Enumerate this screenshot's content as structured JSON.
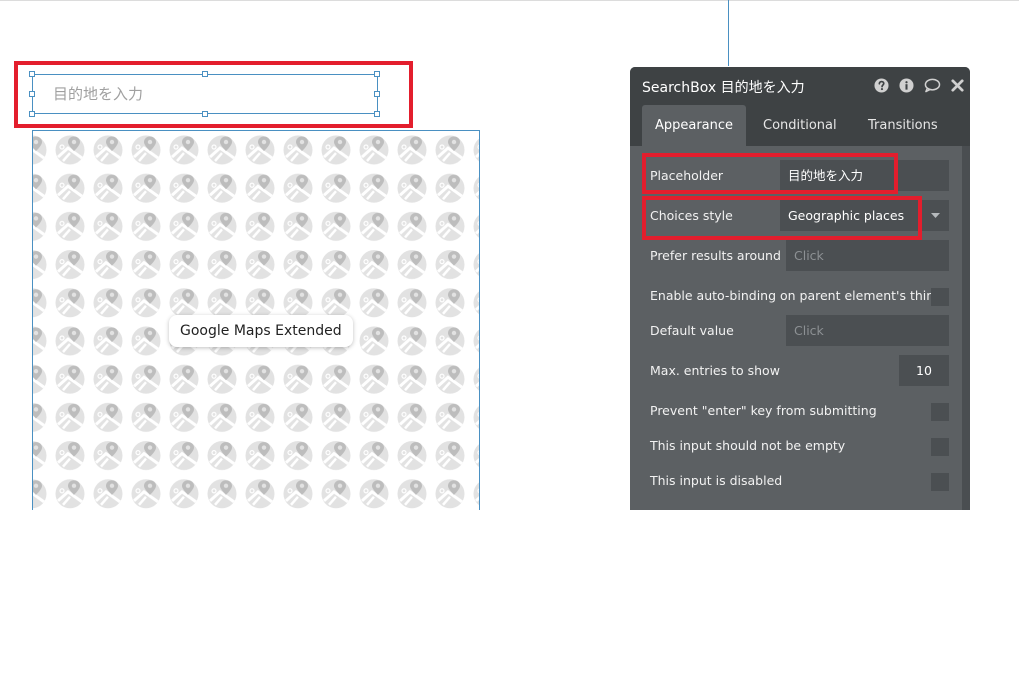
{
  "canvas": {
    "searchbox": {
      "placeholder": "目的地を入力"
    },
    "map": {
      "label": "Google Maps Extended"
    }
  },
  "panel": {
    "title": "SearchBox 目的地を入力",
    "header_icons": [
      "help-icon",
      "info-icon",
      "comment-icon",
      "close-icon"
    ],
    "tabs": [
      {
        "label": "Appearance",
        "active": true
      },
      {
        "label": "Conditional"
      },
      {
        "label": "Transitions"
      }
    ],
    "rows": {
      "placeholder": {
        "label": "Placeholder",
        "value": "目的地を入力"
      },
      "choices_style": {
        "label": "Choices style",
        "value": "Geographic places"
      },
      "prefer_results": {
        "label": "Prefer results around",
        "value": "Click"
      },
      "auto_binding": {
        "label": "Enable auto-binding on parent element's thing"
      },
      "default_value": {
        "label": "Default value",
        "value": "Click"
      },
      "max_entries": {
        "label": "Max. entries to show",
        "value": "10"
      },
      "prevent_enter": {
        "label": "Prevent \"enter\" key from submitting"
      },
      "not_empty": {
        "label": "This input should not be empty"
      },
      "disabled": {
        "label": "This input is disabled"
      }
    }
  },
  "colors": {
    "highlight_red": "#e31e2d",
    "selection_blue": "#4a90c2",
    "panel_bg": "#5c6063",
    "panel_header": "#3e4244"
  }
}
